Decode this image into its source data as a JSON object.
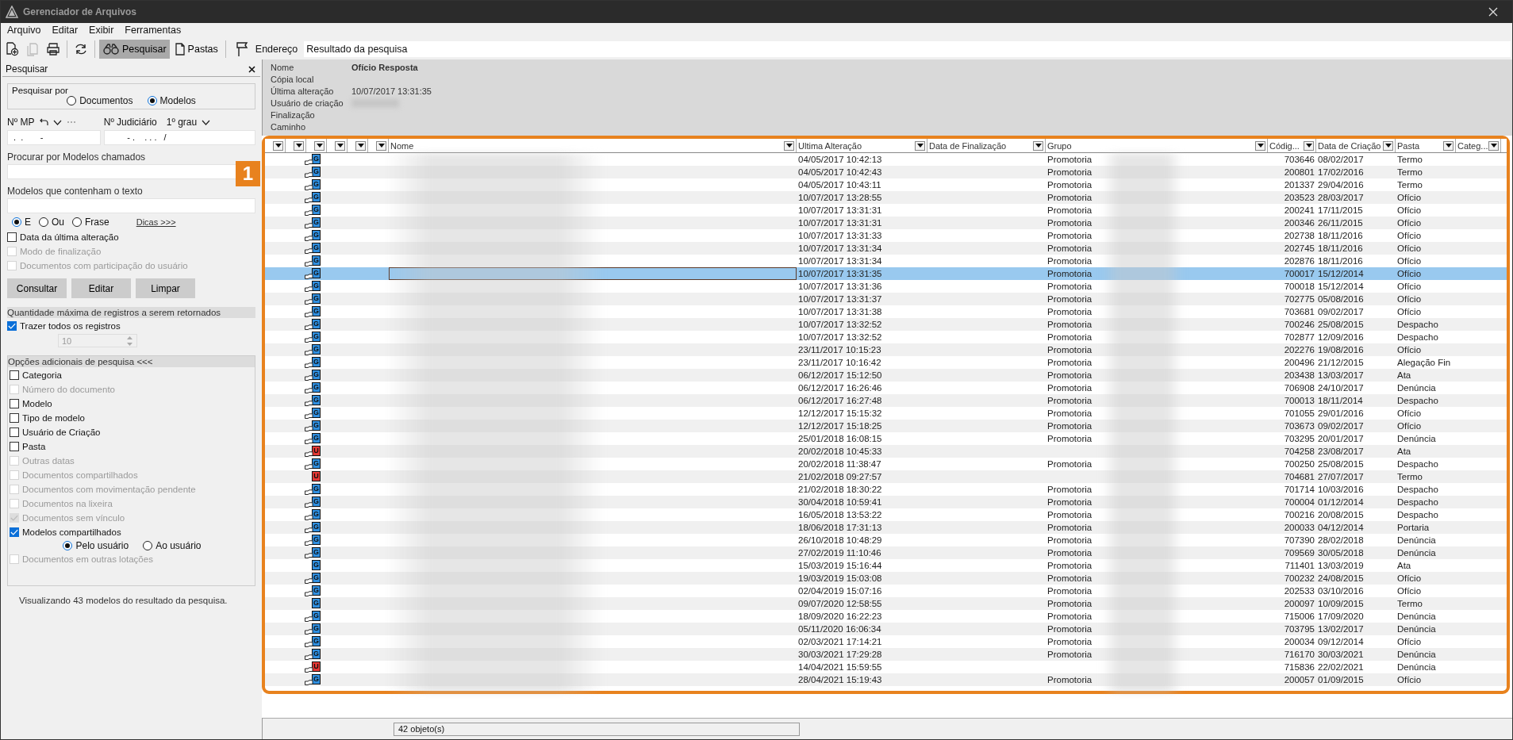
{
  "window": {
    "title": "Gerenciador de Arquivos"
  },
  "menu": [
    "Arquivo",
    "Editar",
    "Exibir",
    "Ferramentas"
  ],
  "toolbar": {
    "tools": [
      {
        "kind": "new",
        "disabled": false
      },
      {
        "kind": "copy",
        "disabled": true
      },
      {
        "kind": "print",
        "disabled": false
      },
      {
        "kind": "refresh",
        "disabled": false
      }
    ],
    "views": [
      {
        "kind": "search",
        "label": "Pesquisar",
        "selected": true
      },
      {
        "kind": "folders",
        "label": "Pastas",
        "selected": false
      }
    ],
    "address_label": "Endereço",
    "address": "Resultado da pesquisa"
  },
  "search_panel": {
    "title": "Pesquisar",
    "search_by": {
      "label": "Pesquisar por",
      "options": [
        {
          "label": "Documentos",
          "selected": false
        },
        {
          "label": "Modelos",
          "selected": true
        }
      ]
    },
    "mp": {
      "label": "Nº MP",
      "value": " .  .       -"
    },
    "judicial": {
      "label": "Nº Judiciário",
      "instance": "1º grau",
      "value": "        - .    . . .   /"
    },
    "name_field": {
      "label": "Procurar por Modelos chamados"
    },
    "text_field": {
      "label": "Modelos que contenham o texto"
    },
    "text_modes": [
      {
        "label": "E",
        "selected": true
      },
      {
        "label": "Ou",
        "selected": false
      },
      {
        "label": "Frase",
        "selected": false
      }
    ],
    "tips_link": "Dicas >>>",
    "filters": [
      {
        "label": "Data da última alteração",
        "checked": false,
        "disabled": false
      },
      {
        "label": "Modo de finalização",
        "checked": false,
        "disabled": true
      },
      {
        "label": "Documentos com participação do usuário",
        "checked": false,
        "disabled": true
      }
    ],
    "buttons": [
      "Consultar",
      "Editar",
      "Limpar"
    ],
    "max_section": "Quantidade máxima de registros a serem retornados",
    "all_records": {
      "label": "Trazer todos os registros",
      "checked": true
    },
    "max_value": {
      "value": "10",
      "disabled": true
    },
    "options_section": "Opções adicionais de pesquisa <<<",
    "options": [
      {
        "kind": "check",
        "label": "Categoria",
        "checked": false,
        "disabled": false
      },
      {
        "kind": "check",
        "label": "Número do documento",
        "checked": false,
        "disabled": true
      },
      {
        "kind": "check",
        "label": "Modelo",
        "checked": false,
        "disabled": false
      },
      {
        "kind": "check",
        "label": "Tipo de modelo",
        "checked": false,
        "disabled": false
      },
      {
        "kind": "check",
        "label": "Usuário de Criação",
        "checked": false,
        "disabled": false
      },
      {
        "kind": "check",
        "label": "Pasta",
        "checked": false,
        "disabled": false
      },
      {
        "kind": "check",
        "label": "Outras datas",
        "checked": false,
        "disabled": true
      },
      {
        "kind": "check",
        "label": "Documentos compartilhados",
        "checked": false,
        "disabled": true
      },
      {
        "kind": "check",
        "label": "Documentos com movimentação pendente",
        "checked": false,
        "disabled": true
      },
      {
        "kind": "check",
        "label": "Documentos na lixeira",
        "checked": false,
        "disabled": true
      },
      {
        "kind": "check",
        "label": "Documentos sem vínculo",
        "checked": true,
        "disabled": true
      },
      {
        "kind": "check",
        "label": "Modelos compartilhados",
        "checked": true,
        "disabled": false
      },
      {
        "kind": "radios",
        "options": [
          {
            "label": "Pelo usuário",
            "selected": true
          },
          {
            "label": "Ao usuário",
            "selected": false
          }
        ]
      },
      {
        "kind": "check",
        "label": "Documentos em outras lotações",
        "checked": false,
        "disabled": true
      }
    ],
    "summary": "Visualizando 43 modelos do resultado da pesquisa."
  },
  "details": [
    {
      "label": "Nome",
      "value": "Ofício Resposta"
    },
    {
      "label": "Cópia local"
    },
    {
      "label": "Última alteração",
      "value": "10/07/2017 13:31:35"
    },
    {
      "label": "Usuário de criação",
      "redacted": true
    },
    {
      "label": "Finalização"
    },
    {
      "label": "Caminho"
    }
  ],
  "table": {
    "columns": [
      {},
      {},
      {},
      {},
      {},
      {},
      {
        "label": "Nome"
      },
      {
        "label": "Ultima Alteração"
      },
      {
        "label": "Data de Finalização"
      },
      {
        "label": "Grupo"
      },
      {
        "label": "Códig..."
      },
      {
        "label": "Data de Criação"
      },
      {
        "label": "Pasta"
      },
      {
        "label": "Categ..."
      }
    ],
    "rows": [
      {
        "badge": "G",
        "color": "#2f8fe0",
        "shared": true,
        "selected": false,
        "modified": "04/05/2017 10:42:13",
        "group": "Promotoria",
        "code": "703646",
        "created": "08/02/2017",
        "folder": "Termo"
      },
      {
        "badge": "G",
        "color": "#2f8fe0",
        "shared": true,
        "selected": false,
        "modified": "04/05/2017 10:42:43",
        "group": "Promotoria",
        "code": "200801",
        "created": "17/02/2016",
        "folder": "Termo"
      },
      {
        "badge": "G",
        "color": "#2f8fe0",
        "shared": true,
        "selected": false,
        "modified": "04/05/2017 10:43:11",
        "group": "Promotoria",
        "code": "201337",
        "created": "29/04/2016",
        "folder": "Termo"
      },
      {
        "badge": "G",
        "color": "#2f8fe0",
        "shared": true,
        "selected": false,
        "modified": "10/07/2017 13:28:55",
        "group": "Promotoria",
        "code": "203523",
        "created": "28/03/2017",
        "folder": "Ofício"
      },
      {
        "badge": "G",
        "color": "#2f8fe0",
        "shared": true,
        "selected": false,
        "modified": "10/07/2017 13:31:31",
        "group": "Promotoria",
        "code": "200241",
        "created": "17/11/2015",
        "folder": "Ofício"
      },
      {
        "badge": "G",
        "color": "#2f8fe0",
        "shared": true,
        "selected": false,
        "modified": "10/07/2017 13:31:31",
        "group": "Promotoria",
        "code": "200346",
        "created": "26/11/2015",
        "folder": "Ofício"
      },
      {
        "badge": "G",
        "color": "#2f8fe0",
        "shared": true,
        "selected": false,
        "modified": "10/07/2017 13:31:33",
        "group": "Promotoria",
        "code": "202738",
        "created": "18/11/2016",
        "folder": "Ofício"
      },
      {
        "badge": "G",
        "color": "#2f8fe0",
        "shared": true,
        "selected": false,
        "modified": "10/07/2017 13:31:34",
        "group": "Promotoria",
        "code": "202745",
        "created": "18/11/2016",
        "folder": "Ofício"
      },
      {
        "badge": "G",
        "color": "#2f8fe0",
        "shared": true,
        "selected": false,
        "modified": "10/07/2017 13:31:34",
        "group": "Promotoria",
        "code": "202876",
        "created": "18/11/2016",
        "folder": "Ofício"
      },
      {
        "badge": "G",
        "color": "#2f8fe0",
        "shared": true,
        "selected": true,
        "modified": "10/07/2017 13:31:35",
        "group": "Promotoria",
        "code": "700017",
        "created": "15/12/2014",
        "folder": "Ofício"
      },
      {
        "badge": "G",
        "color": "#2f8fe0",
        "shared": true,
        "selected": false,
        "modified": "10/07/2017 13:31:36",
        "group": "Promotoria",
        "code": "700018",
        "created": "15/12/2014",
        "folder": "Ofício"
      },
      {
        "badge": "G",
        "color": "#2f8fe0",
        "shared": true,
        "selected": false,
        "modified": "10/07/2017 13:31:37",
        "group": "Promotoria",
        "code": "702775",
        "created": "05/08/2016",
        "folder": "Ofício"
      },
      {
        "badge": "G",
        "color": "#2f8fe0",
        "shared": true,
        "selected": false,
        "modified": "10/07/2017 13:31:38",
        "group": "Promotoria",
        "code": "703681",
        "created": "09/02/2017",
        "folder": "Ofício"
      },
      {
        "badge": "G",
        "color": "#2f8fe0",
        "shared": true,
        "selected": false,
        "modified": "10/07/2017 13:32:52",
        "group": "Promotoria",
        "code": "700246",
        "created": "25/08/2015",
        "folder": "Despacho"
      },
      {
        "badge": "G",
        "color": "#2f8fe0",
        "shared": true,
        "selected": false,
        "modified": "10/07/2017 13:32:52",
        "group": "Promotoria",
        "code": "702877",
        "created": "12/09/2016",
        "folder": "Despacho"
      },
      {
        "badge": "G",
        "color": "#2f8fe0",
        "shared": true,
        "selected": false,
        "modified": "23/11/2017 10:15:23",
        "group": "Promotoria",
        "code": "202276",
        "created": "19/08/2016",
        "folder": "Ofício"
      },
      {
        "badge": "G",
        "color": "#2f8fe0",
        "shared": true,
        "selected": false,
        "modified": "23/11/2017 10:16:42",
        "group": "Promotoria",
        "code": "200496",
        "created": "21/12/2015",
        "folder": "Alegação Fin"
      },
      {
        "badge": "G",
        "color": "#2f8fe0",
        "shared": true,
        "selected": false,
        "modified": "06/12/2017 15:12:50",
        "group": "Promotoria",
        "code": "203438",
        "created": "13/03/2017",
        "folder": "Ata"
      },
      {
        "badge": "G",
        "color": "#2f8fe0",
        "shared": true,
        "selected": false,
        "modified": "06/12/2017 16:26:46",
        "group": "Promotoria",
        "code": "706908",
        "created": "24/10/2017",
        "folder": "Denúncia"
      },
      {
        "badge": "G",
        "color": "#2f8fe0",
        "shared": true,
        "selected": false,
        "modified": "06/12/2017 16:27:48",
        "group": "Promotoria",
        "code": "700013",
        "created": "18/11/2014",
        "folder": "Despacho"
      },
      {
        "badge": "G",
        "color": "#2f8fe0",
        "shared": true,
        "selected": false,
        "modified": "12/12/2017 15:15:32",
        "group": "Promotoria",
        "code": "701055",
        "created": "29/01/2016",
        "folder": "Ofício"
      },
      {
        "badge": "G",
        "color": "#2f8fe0",
        "shared": true,
        "selected": false,
        "modified": "12/12/2017 15:18:25",
        "group": "Promotoria",
        "code": "703673",
        "created": "09/02/2017",
        "folder": "Ofício"
      },
      {
        "badge": "G",
        "color": "#2f8fe0",
        "shared": true,
        "selected": false,
        "modified": "25/01/2018 16:08:15",
        "group": "Promotoria",
        "code": "703295",
        "created": "20/01/2017",
        "folder": "Denúncia"
      },
      {
        "badge": "U",
        "color": "#e53935",
        "shared": true,
        "selected": false,
        "modified": "20/02/2018 10:45:33",
        "code": "704258",
        "created": "23/08/2017",
        "folder": "Ata"
      },
      {
        "badge": "G",
        "color": "#2f8fe0",
        "shared": true,
        "selected": false,
        "modified": "20/02/2018 11:38:47",
        "group": "Promotoria",
        "code": "700250",
        "created": "25/08/2015",
        "folder": "Despacho"
      },
      {
        "badge": "U",
        "color": "#e53935",
        "shared": false,
        "selected": false,
        "modified": "21/02/2018 09:27:57",
        "code": "704681",
        "created": "27/07/2017",
        "folder": "Termo"
      },
      {
        "badge": "G",
        "color": "#2f8fe0",
        "shared": true,
        "selected": false,
        "modified": "21/02/2018 18:30:22",
        "group": "Promotoria",
        "code": "701714",
        "created": "10/03/2016",
        "folder": "Despacho"
      },
      {
        "badge": "G",
        "color": "#2f8fe0",
        "shared": true,
        "selected": false,
        "modified": "30/04/2018 10:59:41",
        "group": "Promotoria",
        "code": "700004",
        "created": "01/12/2014",
        "folder": "Despacho"
      },
      {
        "badge": "G",
        "color": "#2f8fe0",
        "shared": true,
        "selected": false,
        "modified": "16/05/2018 13:53:22",
        "group": "Promotoria",
        "code": "700216",
        "created": "20/08/2015",
        "folder": "Despacho"
      },
      {
        "badge": "G",
        "color": "#2f8fe0",
        "shared": true,
        "selected": false,
        "modified": "18/06/2018 17:31:13",
        "group": "Promotoria",
        "code": "200033",
        "created": "04/12/2014",
        "folder": "Portaria"
      },
      {
        "badge": "G",
        "color": "#2f8fe0",
        "shared": true,
        "selected": false,
        "modified": "26/10/2018 10:48:29",
        "group": "Promotoria",
        "code": "707390",
        "created": "28/02/2018",
        "folder": "Denúncia"
      },
      {
        "badge": "G",
        "color": "#2f8fe0",
        "shared": true,
        "selected": false,
        "modified": "27/02/2019 11:10:46",
        "group": "Promotoria",
        "code": "709569",
        "created": "30/05/2018",
        "folder": "Denúncia"
      },
      {
        "badge": "G",
        "color": "#2f8fe0",
        "shared": false,
        "selected": false,
        "modified": "15/03/2019 15:16:44",
        "group": "Promotoria",
        "code": "711401",
        "created": "13/03/2019",
        "folder": "Ata"
      },
      {
        "badge": "G",
        "color": "#2f8fe0",
        "shared": true,
        "selected": false,
        "modified": "19/03/2019 15:03:08",
        "group": "Promotoria",
        "code": "700232",
        "created": "24/08/2015",
        "folder": "Ofício"
      },
      {
        "badge": "G",
        "color": "#2f8fe0",
        "shared": true,
        "selected": false,
        "modified": "02/04/2019 15:07:16",
        "group": "Promotoria",
        "code": "202533",
        "created": "03/10/2016",
        "folder": "Ofício"
      },
      {
        "badge": "G",
        "color": "#2f8fe0",
        "shared": false,
        "selected": false,
        "modified": "09/07/2020 12:58:55",
        "group": "Promotoria",
        "code": "200097",
        "created": "10/09/2015",
        "folder": "Termo"
      },
      {
        "badge": "G",
        "color": "#2f8fe0",
        "shared": true,
        "selected": false,
        "modified": "18/09/2020 16:22:23",
        "group": "Promotoria",
        "code": "715006",
        "created": "17/09/2020",
        "folder": "Denúncia"
      },
      {
        "badge": "G",
        "color": "#2f8fe0",
        "shared": true,
        "selected": false,
        "modified": "05/11/2020 16:06:34",
        "group": "Promotoria",
        "code": "703795",
        "created": "13/02/2017",
        "folder": "Denúncia"
      },
      {
        "badge": "G",
        "color": "#2f8fe0",
        "shared": true,
        "selected": false,
        "modified": "02/03/2021 17:14:21",
        "group": "Promotoria",
        "code": "200034",
        "created": "09/12/2014",
        "folder": "Ofício"
      },
      {
        "badge": "G",
        "color": "#2f8fe0",
        "shared": true,
        "selected": false,
        "modified": "30/03/2021 17:29:28",
        "group": "Promotoria",
        "code": "716170",
        "created": "30/03/2021",
        "folder": "Denúncia"
      },
      {
        "badge": "U",
        "color": "#e53935",
        "shared": true,
        "selected": false,
        "modified": "14/04/2021 15:59:55",
        "code": "715836",
        "created": "22/02/2021",
        "folder": "Denúncia"
      },
      {
        "badge": "G",
        "color": "#2f8fe0",
        "shared": true,
        "selected": false,
        "modified": "28/04/2021 15:19:43",
        "group": "Promotoria",
        "code": "200057",
        "created": "01/09/2015",
        "folder": "Ofício"
      }
    ]
  },
  "callout": "1",
  "status_bar": {
    "count": "42 objeto(s)"
  }
}
